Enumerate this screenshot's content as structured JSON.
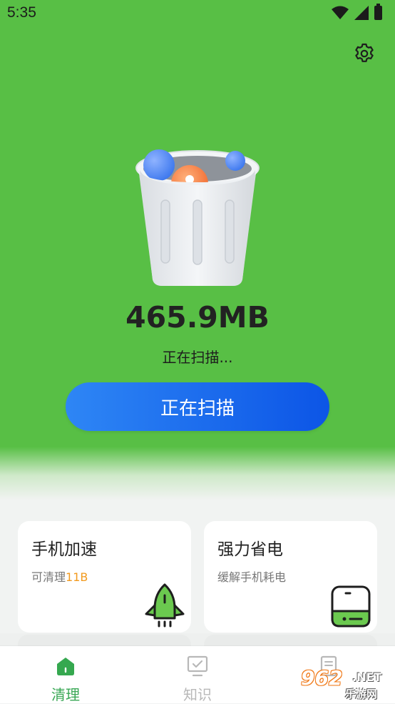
{
  "status_bar": {
    "time": "5:35"
  },
  "hero": {
    "size": "465.9MB",
    "status_text": "正在扫描...",
    "button_label": "正在扫描"
  },
  "cards": [
    {
      "title": "手机加速",
      "subtitle_prefix": "可清理",
      "subtitle_highlight": "11B",
      "icon": "rocket-icon"
    },
    {
      "title": "强力省电",
      "subtitle": "缓解手机耗电",
      "icon": "power-bank-icon"
    }
  ],
  "bottom_nav": [
    {
      "label": "清理",
      "icon": "home-icon",
      "active": true
    },
    {
      "label": "知识",
      "icon": "monitor-icon",
      "active": false
    },
    {
      "label": "",
      "icon": "document-icon",
      "active": false
    }
  ],
  "watermark": {
    "logo": "962",
    "suffix": ".NET",
    "site": "乐游网"
  },
  "colors": {
    "hero_green": "#58bf45",
    "button_blue": "#1a6ff0",
    "active_nav": "#3aa856",
    "inactive_nav": "#b8b8b8",
    "highlight_orange": "#f29a1e"
  }
}
